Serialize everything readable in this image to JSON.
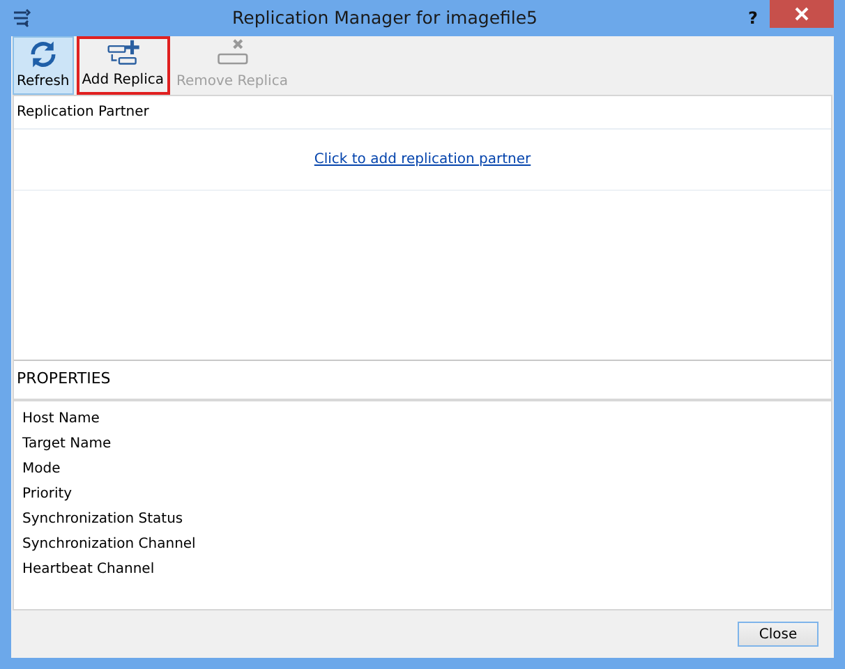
{
  "window": {
    "title": "Replication Manager for imagefile5",
    "help": "?"
  },
  "toolbar": [
    {
      "kind": "refresh",
      "label": "Refresh",
      "selected": true,
      "disabled": false,
      "highlighted": false
    },
    {
      "kind": "add",
      "label": "Add Replica",
      "selected": false,
      "disabled": false,
      "highlighted": true
    },
    {
      "kind": "remove",
      "label": "Remove Replica",
      "selected": false,
      "disabled": true,
      "highlighted": false
    }
  ],
  "partners": {
    "heading": "Replication Partner",
    "link": "Click to add replication partner"
  },
  "properties": {
    "heading": "PROPERTIES",
    "rows": [
      "Host Name",
      "Target Name",
      "Mode",
      "Priority",
      "Synchronization Status",
      "Synchronization Channel",
      "Heartbeat Channel"
    ]
  },
  "buttons": [
    "Close"
  ]
}
